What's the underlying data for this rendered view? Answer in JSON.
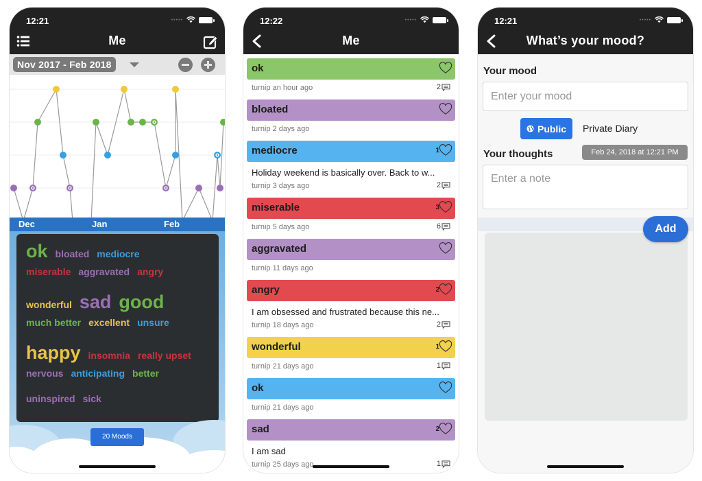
{
  "phones": [
    {
      "status_time": "12:21",
      "title": "Me",
      "range_label": "Nov 2017 - Feb 2018",
      "chart_data": {
        "type": "line",
        "title": "",
        "xlabel": "",
        "ylabel": "",
        "month_labels": [
          "Dec",
          "Jan",
          "Feb"
        ],
        "level_colors": {
          "1": "#e03a3e",
          "2": "#9b6fb5",
          "3": "#3a9ee0",
          "4": "#6cb44a",
          "5": "#f0c83a"
        },
        "ylim": [
          1,
          5
        ],
        "points": [
          {
            "level": 2,
            "ring": false
          },
          {
            "level": 1,
            "ring": false
          },
          {
            "level": 2,
            "ring": true
          },
          {
            "level": 4,
            "ring": false
          },
          {
            "level": 5,
            "ring": false
          },
          {
            "level": 3,
            "ring": false
          },
          {
            "level": 2,
            "ring": true
          },
          {
            "level": 1,
            "ring": true
          },
          {
            "level": 1,
            "ring": false
          },
          {
            "level": 4,
            "ring": false
          },
          {
            "level": 3,
            "ring": false
          },
          {
            "level": 5,
            "ring": false
          },
          {
            "level": 4,
            "ring": false
          },
          {
            "level": 4,
            "ring": false
          },
          {
            "level": 4,
            "ring": true
          },
          {
            "level": 2,
            "ring": true
          },
          {
            "level": 3,
            "ring": false
          },
          {
            "level": 5,
            "ring": false
          },
          {
            "level": 1,
            "ring": true
          },
          {
            "level": 2,
            "ring": false
          },
          {
            "level": 1,
            "ring": false
          },
          {
            "level": 3,
            "ring": true
          },
          {
            "level": 2,
            "ring": false
          },
          {
            "level": 4,
            "ring": false
          }
        ]
      },
      "wordcloud": [
        [
          {
            "text": "ok",
            "color": "#6cb44a",
            "size": "big"
          },
          {
            "text": "bloated",
            "color": "#9b6fb5",
            "size": "small"
          },
          {
            "text": "mediocre",
            "color": "#3a9ee0",
            "size": "small"
          }
        ],
        [
          {
            "text": "miserable",
            "color": "#c8343c",
            "size": "small"
          },
          {
            "text": "aggravated",
            "color": "#9b6fb5",
            "size": "small"
          },
          {
            "text": "angry",
            "color": "#c8343c",
            "size": "small"
          }
        ],
        [
          {
            "text": "wonderful",
            "color": "#e8c34a",
            "size": "small"
          },
          {
            "text": "sad",
            "color": "#9b6fb5",
            "size": "big"
          },
          {
            "text": "good",
            "color": "#6cb44a",
            "size": "big"
          }
        ],
        [
          {
            "text": "much better",
            "color": "#6cb44a",
            "size": "small"
          },
          {
            "text": "excellent",
            "color": "#e8c34a",
            "size": "small"
          },
          {
            "text": "unsure",
            "color": "#3a9ee0",
            "size": "small"
          }
        ],
        [
          {
            "text": "happy",
            "color": "#e8c34a",
            "size": "big"
          },
          {
            "text": "insomnia",
            "color": "#c8343c",
            "size": "small"
          },
          {
            "text": "really upset",
            "color": "#c8343c",
            "size": "small"
          }
        ],
        [
          {
            "text": "nervous",
            "color": "#9b6fb5",
            "size": "small"
          },
          {
            "text": "anticipating",
            "color": "#3a9ee0",
            "size": "small"
          },
          {
            "text": "better",
            "color": "#6cb44a",
            "size": "small"
          }
        ],
        [
          {
            "text": "uninspired",
            "color": "#9b6fb5",
            "size": "small"
          },
          {
            "text": "sick",
            "color": "#9b6fb5",
            "size": "small"
          }
        ]
      ],
      "moods_button": "20 Moods"
    },
    {
      "status_time": "12:22",
      "title": "Me",
      "feed": [
        {
          "mood": "ok",
          "color": "#8cc66a",
          "likes": "",
          "note": "",
          "meta": "turnip an hour ago",
          "comments": "2"
        },
        {
          "mood": "bloated",
          "color": "#b391c6",
          "likes": "",
          "note": "",
          "meta": "turnip 2 days ago",
          "comments": ""
        },
        {
          "mood": "mediocre",
          "color": "#55b4f0",
          "likes": "1",
          "note": "Holiday weekend is basically over. Back to w...",
          "meta": "turnip 3 days ago",
          "comments": "2"
        },
        {
          "mood": "miserable",
          "color": "#e24a4f",
          "likes": "3",
          "note": "",
          "meta": "turnip 5 days ago",
          "comments": "6"
        },
        {
          "mood": "aggravated",
          "color": "#b391c6",
          "likes": "",
          "note": "",
          "meta": "turnip 11 days ago",
          "comments": ""
        },
        {
          "mood": "angry",
          "color": "#e24a4f",
          "likes": "2",
          "note": "I am obsessed and frustrated because this ne...",
          "meta": "turnip 18 days ago",
          "comments": "2"
        },
        {
          "mood": "wonderful",
          "color": "#f2d24d",
          "likes": "1",
          "note": "",
          "meta": "turnip 21 days ago",
          "comments": "1"
        },
        {
          "mood": "ok",
          "color": "#55b4f0",
          "likes": "",
          "note": "",
          "meta": "turnip 21 days ago",
          "comments": ""
        },
        {
          "mood": "sad",
          "color": "#b391c6",
          "likes": "2",
          "note": "I am sad",
          "meta": "turnip 25 days ago",
          "comments": "1"
        }
      ]
    },
    {
      "status_time": "12:21",
      "title": "What’s your mood?",
      "mood_label": "Your mood",
      "mood_placeholder": "Enter your mood",
      "privacy_public": "Public",
      "privacy_private": "Private Diary",
      "thoughts_label": "Your thoughts",
      "date": "Feb 24, 2018 at 12:21 PM",
      "note_placeholder": "Enter a note",
      "add_button": "Add"
    }
  ]
}
